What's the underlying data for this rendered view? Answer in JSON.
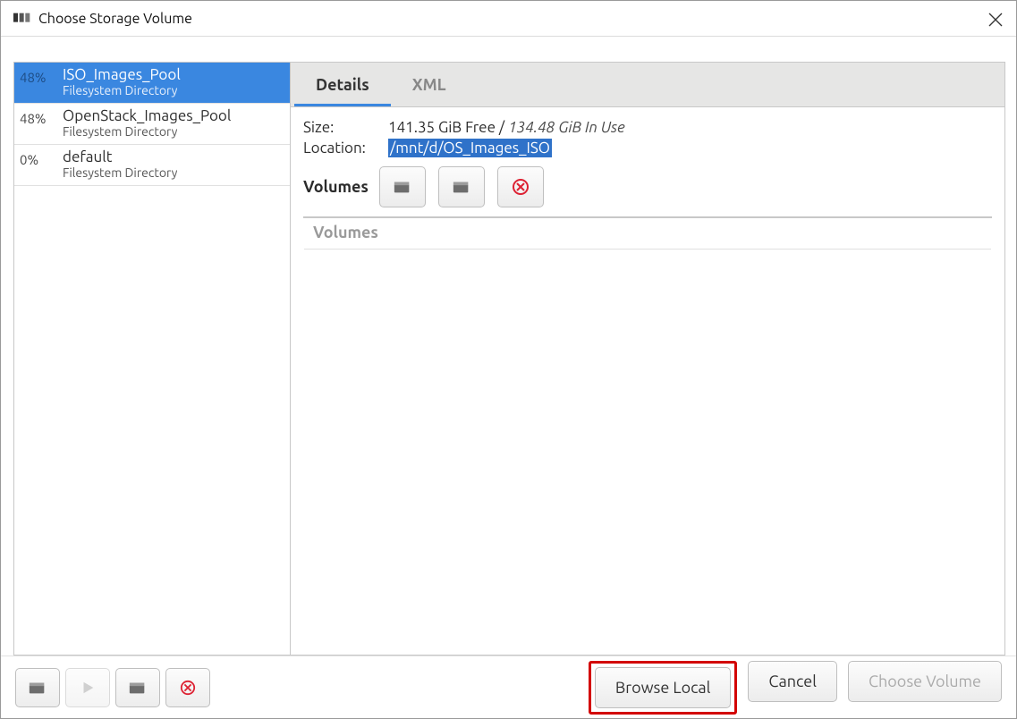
{
  "window": {
    "title": "Choose Storage Volume"
  },
  "pools": [
    {
      "pct": "48%",
      "name": "ISO_Images_Pool",
      "type": "Filesystem Directory",
      "selected": true
    },
    {
      "pct": "48%",
      "name": "OpenStack_Images_Pool",
      "type": "Filesystem Directory",
      "selected": false
    },
    {
      "pct": "0%",
      "name": "default",
      "type": "Filesystem Directory",
      "selected": false
    }
  ],
  "tabs": {
    "details": "Details",
    "xml": "XML"
  },
  "details": {
    "size_label": "Size:",
    "size_free": "141.35 GiB Free",
    "size_sep": " / ",
    "size_used": "134.48 GiB In Use",
    "location_label": "Location:",
    "location_value": "/mnt/d/OS_Images_ISO",
    "volumes_label": "Volumes",
    "volumes_list_header": "Volumes"
  },
  "footer": {
    "browse_local": "Browse Local",
    "cancel": "Cancel",
    "choose_volume": "Choose Volume"
  }
}
